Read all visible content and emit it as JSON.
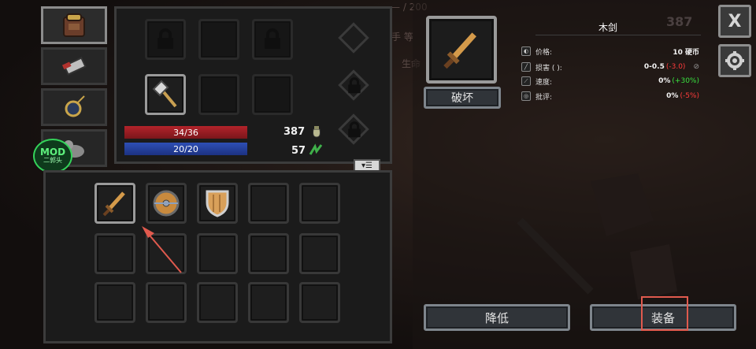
{
  "background": {
    "hp_top_text": "— / 200",
    "ghost_text_1": "手 等",
    "ghost_text_2": "生命"
  },
  "side_tabs": [
    {
      "icon": "backpack-icon",
      "active": true
    },
    {
      "icon": "scroll-icon",
      "active": false
    },
    {
      "icon": "amulet-icon",
      "active": false
    },
    {
      "icon": "cat-icon",
      "active": false
    }
  ],
  "mod_badge": {
    "title": "MOD",
    "subtitle": "二郭头"
  },
  "equipment": {
    "health": {
      "text": "34/36",
      "current": 34,
      "max": 36
    },
    "mana": {
      "text": "20/20",
      "current": 20,
      "max": 20
    },
    "gold": "387",
    "herbs": "57"
  },
  "inventory_menu_icon": "list-menu-icon",
  "item_detail": {
    "name": "木剑",
    "destroy_label": "破坏",
    "stats": [
      {
        "label": "价格:",
        "value": "10 硬币",
        "delta": "",
        "icon": "coin-bag-icon"
      },
      {
        "label": "损害 (   ):",
        "value": "0-0.5",
        "delta": "(-3.0)",
        "delta_type": "neg",
        "icon": "damage-icon"
      },
      {
        "label": "速度:",
        "value": "0%",
        "delta": "(+30%)",
        "delta_type": "pos",
        "icon": "speed-icon"
      },
      {
        "label": "批评:",
        "value": "0%",
        "delta": "(-5%)",
        "delta_type": "neg",
        "icon": "crit-icon"
      }
    ],
    "downgrade_label": "降低",
    "equip_label": "装备"
  },
  "top_right": {
    "gold": "387",
    "close_glyph": "X",
    "settings_icon": "gear-icon"
  },
  "colors": {
    "health_bar": "#b3232a",
    "mana_bar": "#2e4fb5",
    "negative": "#ff3b3b",
    "positive": "#39e23f",
    "highlight": "#e05a4e"
  }
}
